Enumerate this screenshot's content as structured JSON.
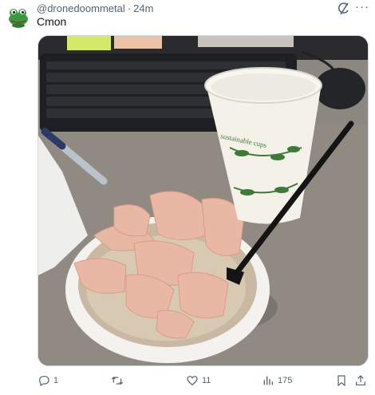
{
  "post": {
    "handle": "@dronedoommetal",
    "separator": "·",
    "time": "24m",
    "text": "Cmon",
    "media_alt": "Photo of a paper bowl of rice topped with chunks of chicken and a black plastic fork, next to a paper cup, in front of a computer keyboard and mouse",
    "cup_print": "sustainable cups"
  },
  "actions": {
    "replies": "1",
    "reposts": "",
    "likes": "11",
    "views": "175"
  },
  "colors": {
    "secondary_text": "#536471",
    "primary_text": "#0f1419",
    "avatar_green": "#2e8b3a"
  },
  "icons": {
    "avatar": "frog-avatar",
    "grok": "grok-icon",
    "more": "more-icon",
    "reply": "reply-icon",
    "repost": "repost-icon",
    "like": "like-icon",
    "views": "views-icon",
    "bookmark": "bookmark-icon",
    "share": "share-icon"
  }
}
